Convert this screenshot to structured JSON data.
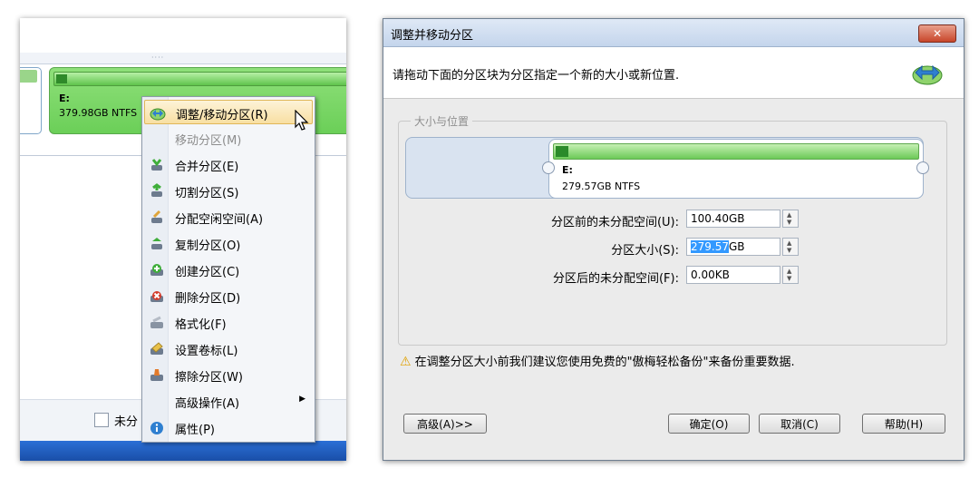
{
  "left_panel": {
    "partition": {
      "label": "E:",
      "size": "379.98GB NTFS"
    },
    "checkbox_label": "未分"
  },
  "context_menu": {
    "items": [
      {
        "label": "调整/移动分区(R)",
        "icon": "resize-move-icon",
        "highlighted": true
      },
      {
        "label": "移动分区(M)",
        "icon": "",
        "disabled": true
      },
      {
        "label": "合并分区(E)",
        "icon": "merge-icon"
      },
      {
        "label": "切割分区(S)",
        "icon": "split-icon"
      },
      {
        "label": "分配空闲空间(A)",
        "icon": "allocate-space-icon"
      },
      {
        "label": "复制分区(O)",
        "icon": "copy-partition-icon"
      },
      {
        "label": "创建分区(C)",
        "icon": "create-partition-icon"
      },
      {
        "label": "删除分区(D)",
        "icon": "delete-partition-icon"
      },
      {
        "label": "格式化(F)",
        "icon": "format-icon"
      },
      {
        "label": "设置卷标(L)",
        "icon": "label-icon"
      },
      {
        "label": "擦除分区(W)",
        "icon": "wipe-icon"
      },
      {
        "label": "高级操作(A)",
        "icon": "",
        "submenu": true
      },
      {
        "label": "属性(P)",
        "icon": "info-icon"
      }
    ]
  },
  "dialog": {
    "title": "调整并移动分区",
    "close_label": "✕",
    "instruction": "请拖动下面的分区块为分区指定一个新的大小或新位置.",
    "group_title": "大小与位置",
    "partition": {
      "label": "E:",
      "size": "279.57GB NTFS"
    },
    "fields": {
      "before": {
        "label": "分区前的未分配空间(U):",
        "value": "100.40GB"
      },
      "size": {
        "label": "分区大小(S):",
        "value_selected": "279.57",
        "value_unit": "GB"
      },
      "after": {
        "label": "分区后的未分配空间(F):",
        "value": "0.00KB"
      }
    },
    "warning": "在调整分区大小前我们建议您使用免费的\"傲梅轻松备份\"来备份重要数据.",
    "buttons": {
      "advanced": "高级(A)>>",
      "ok": "确定(O)",
      "cancel": "取消(C)",
      "help": "帮助(H)"
    }
  },
  "colors": {
    "partition_green": "#6bcf58",
    "highlight": "#f8dfa2",
    "selection": "#3399ff",
    "title_bar": "#c4d5ec",
    "close_button": "#c8462a"
  }
}
